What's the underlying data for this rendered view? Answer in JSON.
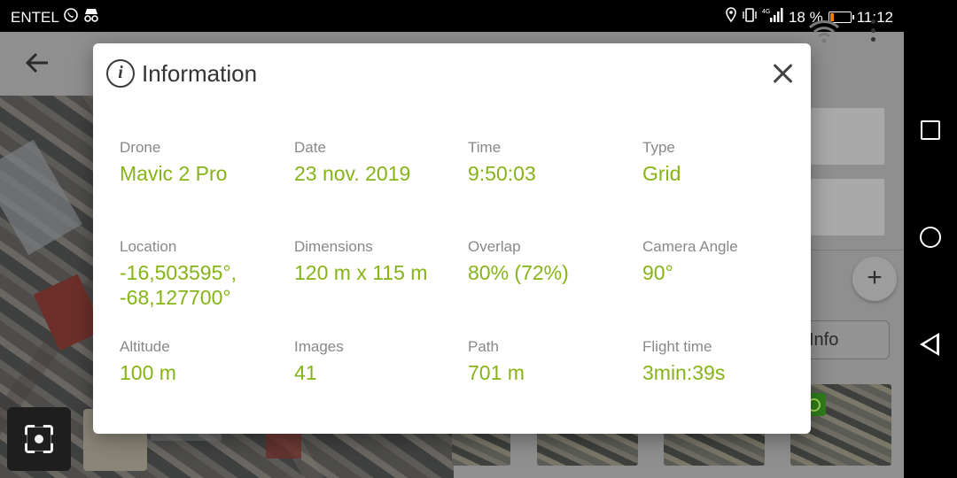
{
  "status_bar": {
    "carrier": "ENTEL",
    "battery_percent": "18 %",
    "battery_level": 0.18,
    "time": "11:12",
    "network": "4G"
  },
  "app_bar": {
    "back_icon": "arrow-back-icon",
    "wifi_icon": "wifi-icon",
    "more_icon": "more-vert-icon"
  },
  "panel": {
    "info_button_label": "Info",
    "add_icon": "plus-icon"
  },
  "dialog": {
    "title": "Information",
    "fields": [
      {
        "label": "Drone",
        "value": "Mavic 2 Pro"
      },
      {
        "label": "Date",
        "value": "23 nov. 2019"
      },
      {
        "label": "Time",
        "value": "9:50:03"
      },
      {
        "label": "Type",
        "value": "Grid"
      },
      {
        "label": "Location",
        "value": "-16,503595°,",
        "value2": "-68,127700°"
      },
      {
        "label": "Dimensions",
        "value": "120 m x 115 m"
      },
      {
        "label": "Overlap",
        "value": "80% (72%)"
      },
      {
        "label": "Camera Angle",
        "value": "90°"
      },
      {
        "label": "Altitude",
        "value": "100 m"
      },
      {
        "label": "Images",
        "value": "41"
      },
      {
        "label": "Path",
        "value": "701 m"
      },
      {
        "label": "Flight time",
        "value": "3min:39s"
      }
    ]
  },
  "colors": {
    "accent_green": "#86b416",
    "label_gray": "#888888",
    "battery_orange": "#ff7a00"
  }
}
